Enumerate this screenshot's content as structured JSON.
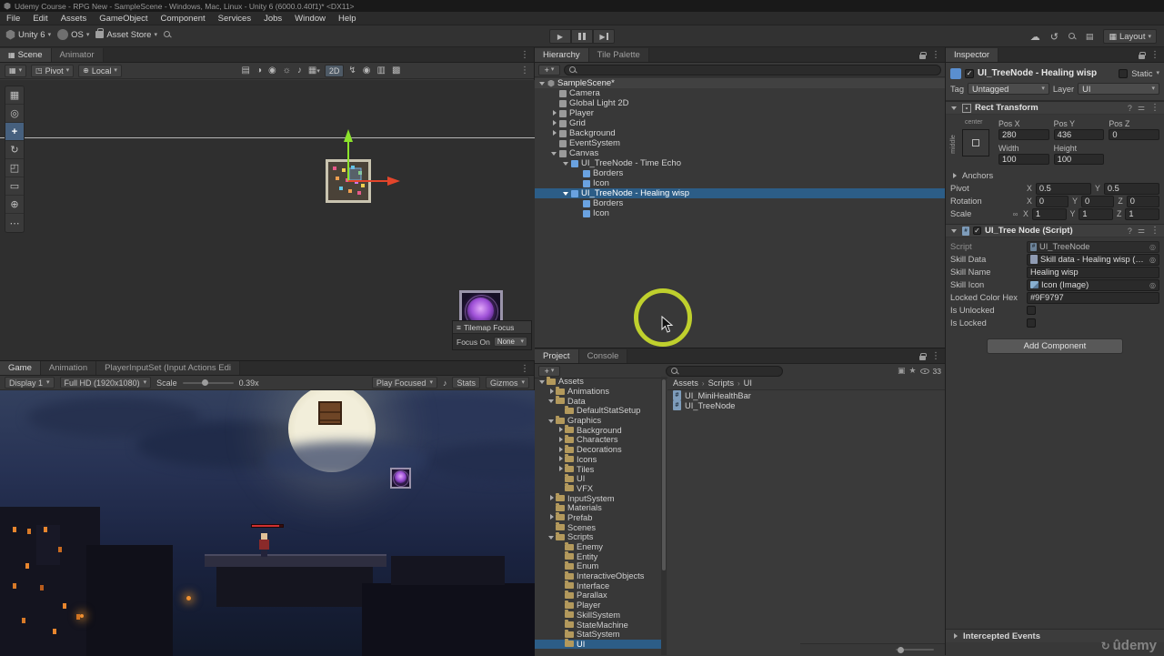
{
  "title_bar": {
    "title": "Udemy Course - RPG New - SampleScene - Windows, Mac, Linux - Unity 6 (6000.0.40f1)* <DX11>"
  },
  "menu_bar": {
    "items": [
      "File",
      "Edit",
      "Assets",
      "GameObject",
      "Component",
      "Services",
      "Jobs",
      "Window",
      "Help"
    ]
  },
  "toolbar": {
    "unity_label": "Unity 6",
    "account_label": "OS",
    "asset_store_label": "Asset Store",
    "layout_label": "Layout"
  },
  "scene": {
    "tab_scene": "Scene",
    "tab_animator": "Animator",
    "pivot_label": "Pivot",
    "local_label": "Local",
    "two_d_label": "2D",
    "tilemap_focus_title": "Tilemap Focus",
    "focus_on_label": "Focus On",
    "focus_on_value": "None"
  },
  "game": {
    "tab_game": "Game",
    "tab_animation": "Animation",
    "tab_inputset": "PlayerInputSet (Input Actions Edi",
    "display_label": "Display 1",
    "resolution_label": "Full HD (1920x1080)",
    "scale_label": "Scale",
    "scale_value": "0.39x",
    "play_focused_label": "Play Focused",
    "stats_label": "Stats",
    "gizmos_label": "Gizmos"
  },
  "hierarchy": {
    "tab_hierarchy": "Hierarchy",
    "tab_tile_palette": "Tile Palette",
    "items": [
      "SampleScene*",
      "Camera",
      "Global Light 2D",
      "Player",
      "Grid",
      "Background",
      "EventSystem",
      "Canvas",
      "UI_TreeNode - Time Echo",
      "Borders",
      "Icon",
      "UI_TreeNode - Healing wisp",
      "Borders",
      "Icon"
    ]
  },
  "project": {
    "tab_project": "Project",
    "tab_console": "Console",
    "count_badge": "33",
    "breadcrumb": [
      "Assets",
      "Scripts",
      "UI"
    ],
    "files": [
      "UI_MiniHealthBar",
      "UI_TreeNode"
    ],
    "tree": [
      "Assets",
      "Animations",
      "Data",
      "DefaultStatSetup",
      "Graphics",
      "Background",
      "Characters",
      "Decorations",
      "Icons",
      "Tiles",
      "UI",
      "VFX",
      "InputSystem",
      "Materials",
      "Prefab",
      "Scenes",
      "Scripts",
      "Enemy",
      "Entity",
      "Enum",
      "InteractiveObjects",
      "Interface",
      "Parallax",
      "Player",
      "SkillSystem",
      "StateMachine",
      "StatSystem",
      "UI"
    ]
  },
  "inspector": {
    "tab": "Inspector",
    "name": "UI_TreeNode - Healing wisp",
    "static_label": "Static",
    "tag_label": "Tag",
    "tag_value": "Untagged",
    "layer_label": "Layer",
    "layer_value": "UI",
    "rect_transform": {
      "title": "Rect Transform",
      "anchor_top": "center",
      "anchor_left": "middle",
      "pos_x_label": "Pos X",
      "pos_y_label": "Pos Y",
      "pos_z_label": "Pos Z",
      "pos_x": "280",
      "pos_y": "436",
      "pos_z": "0",
      "width_label": "Width",
      "height_label": "Height",
      "width": "100",
      "height": "100",
      "anchors_label": "Anchors",
      "pivot_label": "Pivot",
      "rotation_label": "Rotation",
      "scale_label": "Scale",
      "x_label": "X",
      "y_label": "Y",
      "z_label": "Z",
      "pivot_x": "0.5",
      "pivot_y": "0.5",
      "rot_x": "0",
      "rot_y": "0",
      "rot_z": "0",
      "scale_x": "1",
      "scale_y": "1",
      "scale_z": "1"
    },
    "script": {
      "title": "UI_Tree Node (Script)",
      "script_label": "Script",
      "script_value": "UI_TreeNode",
      "skill_data_label": "Skill Data",
      "skill_data_value": "Skill data - Healing wisp (Skill",
      "skill_name_label": "Skill Name",
      "skill_name_value": "Healing wisp",
      "skill_icon_label": "Skill Icon",
      "skill_icon_value": "Icon (Image)",
      "locked_color_label": "Locked Color Hex",
      "locked_color_value": "#9F9797",
      "is_unlocked_label": "Is Unlocked",
      "is_locked_label": "Is Locked"
    },
    "add_component_label": "Add Component",
    "intercepted_events_label": "Intercepted Events"
  },
  "watermark": "ûdemy"
}
